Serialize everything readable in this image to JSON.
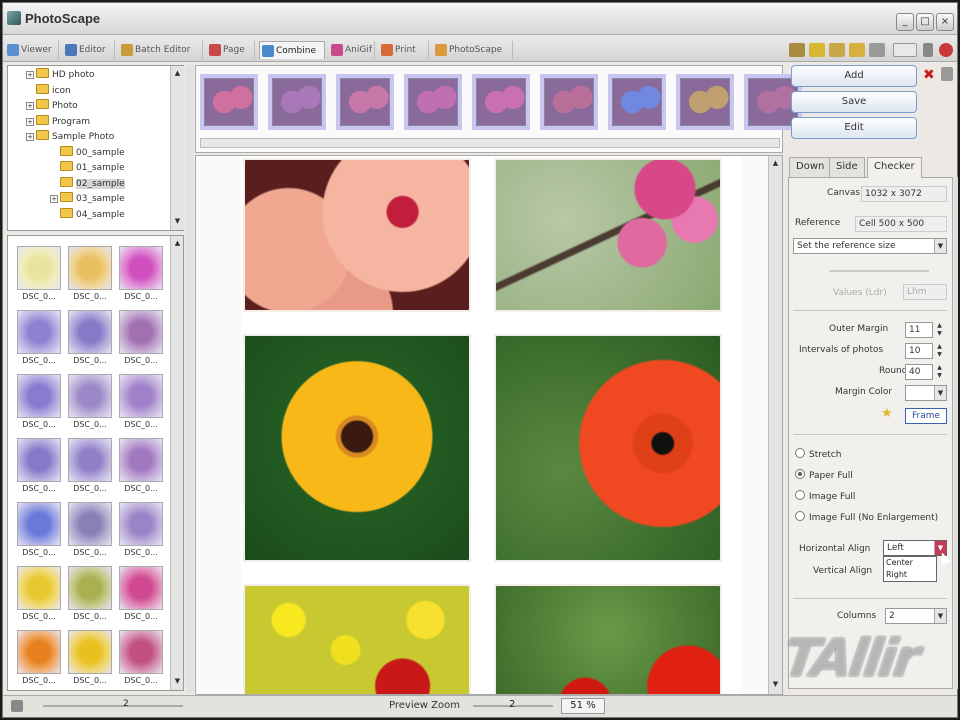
{
  "window": {
    "title": "PhotoScape"
  },
  "tabs": [
    {
      "label": "Viewer",
      "icon": "viewer-icon",
      "color": "#5a8fcf"
    },
    {
      "label": "Editor",
      "icon": "editor-icon",
      "color": "#4a78b8"
    },
    {
      "label": "Batch Editor",
      "icon": "batch-editor-icon",
      "color": "#c89a3a"
    },
    {
      "label": "Page",
      "icon": "page-icon",
      "color": "#c84a4a"
    },
    {
      "label": "Combine",
      "icon": "combine-icon",
      "color": "#4a8ac8"
    },
    {
      "label": "AniGif",
      "icon": "anigif-icon",
      "color": "#c84a88"
    },
    {
      "label": "Print",
      "icon": "print-icon",
      "color": "#d86a3a"
    },
    {
      "label": "PhotoScape",
      "icon": "photoscape-icon",
      "color": "#d89a3a"
    }
  ],
  "active_tab": "Combine",
  "tree": [
    {
      "label": "HD photo",
      "expandable": true
    },
    {
      "label": "icon",
      "expandable": false
    },
    {
      "label": "Photo",
      "expandable": true
    },
    {
      "label": "Program",
      "expandable": true
    },
    {
      "label": "Sample Photo",
      "expandable": true
    },
    {
      "label": "00_sample",
      "expandable": false
    },
    {
      "label": "01_sample",
      "expandable": false
    },
    {
      "label": "02_sample",
      "expandable": false,
      "selected": true
    },
    {
      "label": "03_sample",
      "expandable": true
    },
    {
      "label": "04_sample",
      "expandable": false
    }
  ],
  "thumbnails": {
    "caption": "DSC_0...",
    "colors": [
      "#e8e4a0",
      "#e8c060",
      "#d050c0",
      "#9080d0",
      "#8878c8",
      "#a070b0",
      "#8a7ad0",
      "#9a88c8",
      "#a080c8",
      "#8878c8",
      "#9080c8",
      "#a078c0",
      "#6a78d8",
      "#8a80b8",
      "#9a84c8",
      "#e8c830",
      "#a8b050",
      "#d04890",
      "#e88020",
      "#e8c020",
      "#c05080"
    ]
  },
  "filmstrip_colors": [
    "#d070a0",
    "#a878b8",
    "#c878a8",
    "#c070b0",
    "#c870b0",
    "#b87098",
    "#7088e0",
    "#c0a070",
    "#b070a0"
  ],
  "buttons": {
    "add": "Add",
    "save": "Save",
    "edit": "Edit"
  },
  "right_tabs": [
    "Down",
    "Side",
    "Checker"
  ],
  "active_right_tab": "Checker",
  "panel": {
    "canvas_label": "Canvas",
    "canvas_value": "1032 x 3072",
    "reference_label": "Reference",
    "reference_value": "Cell 500 x 500",
    "reference_dropdown": "Set the reference size",
    "values_label": "Values (Ldr)",
    "values_button": "Lhm",
    "outer_margin_label": "Outer Margin",
    "outer_margin_value": "11",
    "intervals_label": "Intervals of photos",
    "intervals_value": "10",
    "round_label": "Round",
    "round_value": "40",
    "margin_color_label": "Margin Color",
    "frame_button": "Frame",
    "fit_options": [
      {
        "label": "Stretch",
        "checked": false
      },
      {
        "label": "Paper Full",
        "checked": true
      },
      {
        "label": "Image Full",
        "checked": false
      },
      {
        "label": "Image Full (No Enlargement)",
        "checked": false
      }
    ],
    "horizontal_align_label": "Horizontal Align",
    "horizontal_align_value": "Left",
    "align_options": [
      "Center",
      "Right"
    ],
    "vertical_align_label": "Vertical Align",
    "columns_label": "Columns",
    "columns_value": "2"
  },
  "status": {
    "preview_zoom_label": "Preview Zoom",
    "zoom_value": "2",
    "zoom_percent": "51 %",
    "left_value": "2"
  },
  "watermark": "TAllir"
}
